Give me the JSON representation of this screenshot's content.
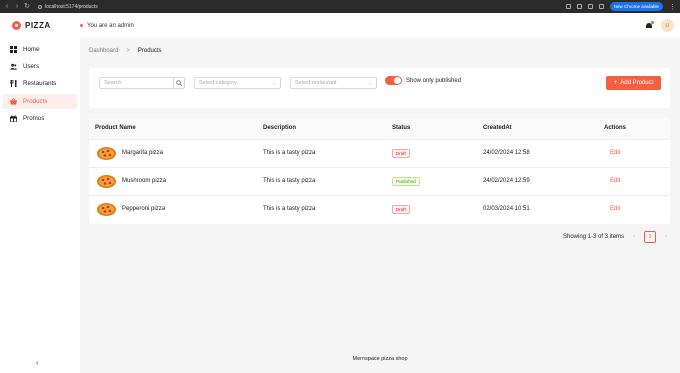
{
  "browser": {
    "url": "localhost:5174/products",
    "update_label": "New Chrome available"
  },
  "header": {
    "logo_text": "PIZZA",
    "admin_text": "You are an admin",
    "avatar_initial": "U"
  },
  "sidebar": {
    "items": [
      {
        "label": "Home",
        "icon": "home-icon"
      },
      {
        "label": "Users",
        "icon": "users-icon"
      },
      {
        "label": "Restaurants",
        "icon": "restaurant-icon"
      },
      {
        "label": "Products",
        "icon": "basket-icon",
        "active": true
      },
      {
        "label": "Promos",
        "icon": "gift-icon"
      }
    ],
    "collapse_glyph": "‹"
  },
  "breadcrumb": {
    "parent": "Dashboard",
    "separator": ">",
    "current": "Products"
  },
  "filters": {
    "search_placeholder": "Search",
    "category_placeholder": "Select category",
    "restaurant_placeholder": "Select restaurant",
    "toggle_label": "Show only published",
    "toggle_on": true,
    "add_button_label": "Add Product"
  },
  "table": {
    "columns": [
      "Product Name",
      "Description",
      "Status",
      "CreatedAt",
      "Actions"
    ],
    "rows": [
      {
        "name": "Margarita pizza",
        "description": "This is a tasty pizza",
        "status": "Draft",
        "created": "24/02/2024 12:58",
        "action": "Edit"
      },
      {
        "name": "Mushroom pizza",
        "description": "This is a tasty pizza",
        "status": "Published",
        "created": "24/02/2024 12:59",
        "action": "Edit"
      },
      {
        "name": "Pepperoni pizza",
        "description": "This is a tasty pizza",
        "status": "Draft",
        "created": "02/03/2024 10:51",
        "action": "Edit"
      }
    ]
  },
  "pagination": {
    "summary": "Showing 1-3 of 3 items",
    "current_page": "1",
    "prev_glyph": "‹",
    "next_glyph": "›"
  },
  "footer": {
    "text": "Mernspace pizza shop"
  },
  "colors": {
    "accent": "#f65f42",
    "draft": "#cf1322",
    "published": "#389e0d"
  }
}
